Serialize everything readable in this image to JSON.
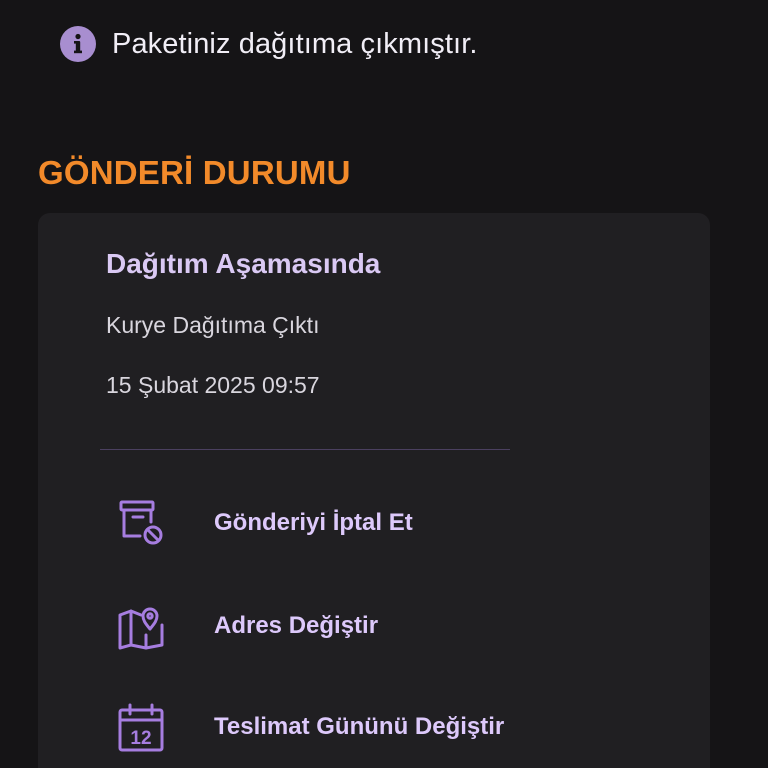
{
  "banner": {
    "icon": "info-icon",
    "text": "Paketiniz dağıtıma çıkmıştır."
  },
  "section": {
    "title": "GÖNDERİ DURUMU"
  },
  "status": {
    "title": "Dağıtım Aşamasında",
    "description": "Kurye Dağıtıma Çıktı",
    "datetime": "15 Şubat 2025 09:57"
  },
  "actions": [
    {
      "label": "Gönderiyi İptal Et",
      "icon": "cancel-shipment-icon"
    },
    {
      "label": "Adres Değiştir",
      "icon": "map-pin-icon"
    },
    {
      "label": "Teslimat Gününü Değiştir",
      "icon": "calendar-icon",
      "icon_text": "12"
    }
  ],
  "colors": {
    "accent": "#f28a2a",
    "primary": "#a67de0",
    "background": "#151416",
    "card": "#201f22"
  }
}
